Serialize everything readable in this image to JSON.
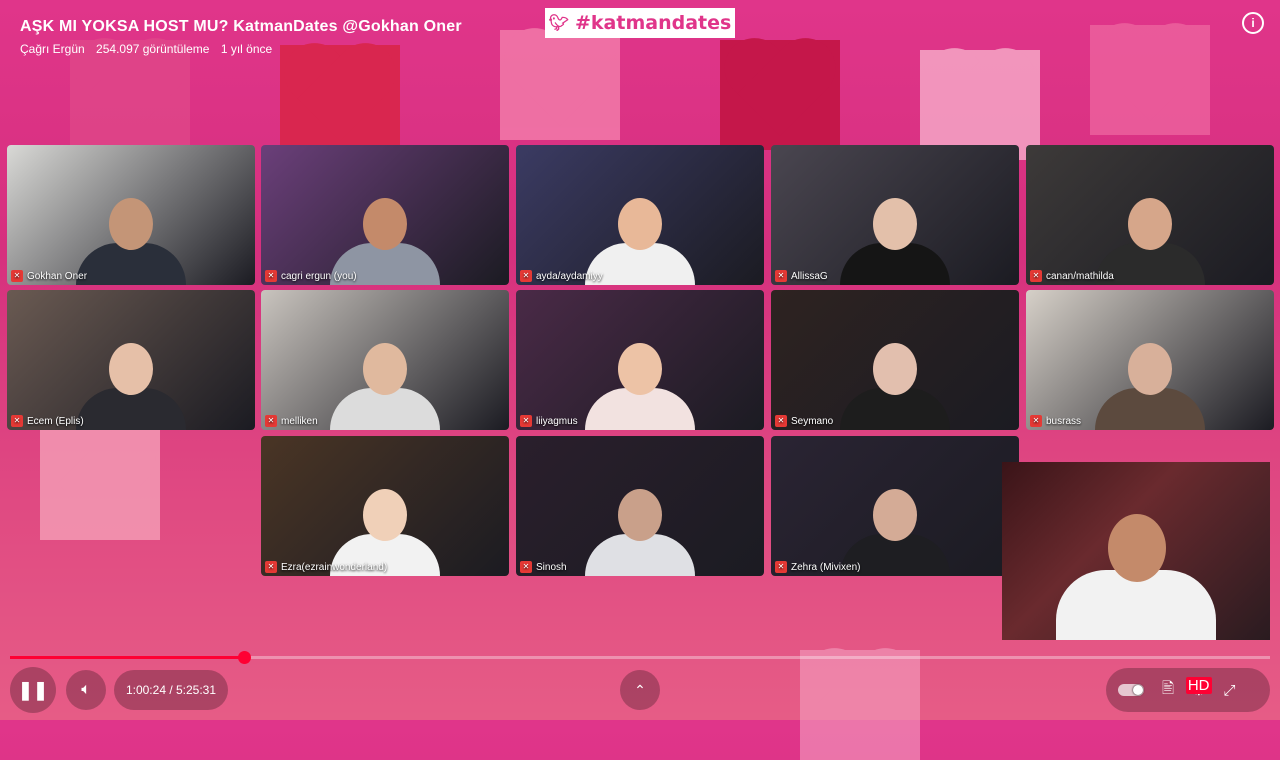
{
  "video": {
    "title": "AŞK MI YOKSA HOST MU? KatmanDates @Gokhan Oner",
    "channel": "Çağrı Ergün",
    "views": "254.097 görüntüleme",
    "age": "1 yıl önce"
  },
  "banner": {
    "hashtag": "#katmandates",
    "icon": "twitter-bird-icon"
  },
  "participants": [
    {
      "name": "Gokhan Oner",
      "bg": "#d9d9d6",
      "skin": "#c49577",
      "cloth": "#2a2f3a"
    },
    {
      "name": "cagri ergun (you)",
      "bg": "#6b3f7a",
      "skin": "#c48a6a",
      "cloth": "#8e95a3"
    },
    {
      "name": "ayda/aydamiyy",
      "bg": "#3b3b63",
      "skin": "#e8b898",
      "cloth": "#f0f0f0"
    },
    {
      "name": "AllissaG",
      "bg": "#4a4650",
      "skin": "#e3c0aa",
      "cloth": "#151515"
    },
    {
      "name": "canan/mathilda",
      "bg": "#3d3a39",
      "skin": "#d6a68a",
      "cloth": "#2b2b2b"
    },
    {
      "name": "Ecem (Eplis)",
      "bg": "#6a5a52",
      "skin": "#e6c0a8",
      "cloth": "#2a2a30"
    },
    {
      "name": "melliken",
      "bg": "#c9c4be",
      "skin": "#e0b99e",
      "cloth": "#dcdcdc"
    },
    {
      "name": "liiyagmus",
      "bg": "#4a2a47",
      "skin": "#edc3a6",
      "cloth": "#f2e2e0"
    },
    {
      "name": "Seymano",
      "bg": "#2e2321",
      "skin": "#e2bfae",
      "cloth": "#1d1d1d"
    },
    {
      "name": "busrass",
      "bg": "#d6d0c8",
      "skin": "#d8b09a",
      "cloth": "#5c4a3e"
    },
    {
      "name": "Ezra(ezrainwonderland)",
      "bg": "#4a3525",
      "skin": "#f0d0b8",
      "cloth": "#f2f2f2"
    },
    {
      "name": "Sinosh",
      "bg": "#2a1f2c",
      "skin": "#c9a08a",
      "cloth": "#dfe0e4"
    },
    {
      "name": "Zehra (Mivixen)",
      "bg": "#2a2433",
      "skin": "#d4ab96",
      "cloth": "#1e1e22"
    }
  ],
  "player": {
    "time": "1:00:24 / 5:25:31",
    "progress_fraction": 0.1854,
    "play_state_icon": "pause-icon",
    "colors": {
      "accent": "#ff0033"
    }
  }
}
